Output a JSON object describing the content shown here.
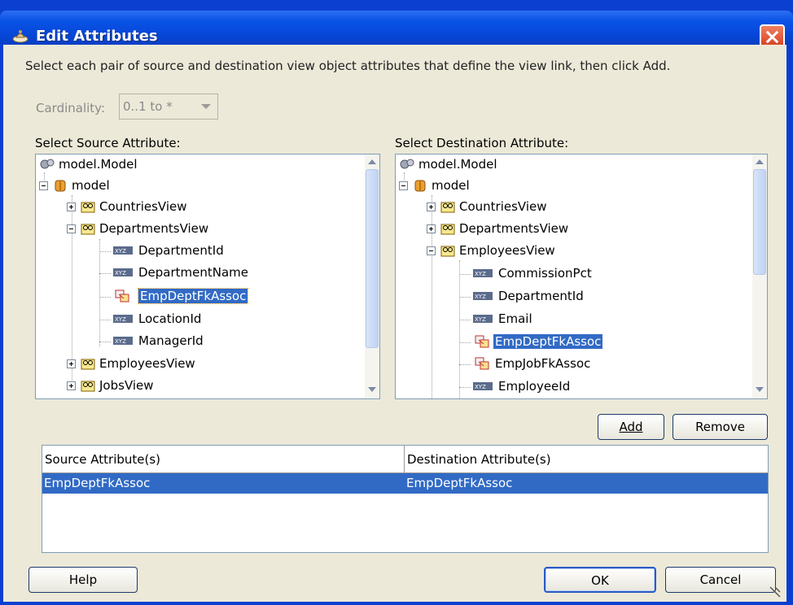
{
  "window": {
    "title": "Edit Attributes"
  },
  "instruction": "Select each pair of source and destination view object attributes that define the view link, then click Add.",
  "cardinality": {
    "label": "Cardinality:",
    "value": "0..1 to *"
  },
  "source": {
    "label": "Select Source Attribute:",
    "rows": [
      "model.Model",
      "model",
      "CountriesView",
      "DepartmentsView",
      "DepartmentId",
      "DepartmentName",
      "EmpDeptFkAssoc",
      "LocationId",
      "ManagerId",
      "EmployeesView",
      "JobsView"
    ]
  },
  "destination": {
    "label": "Select Destination Attribute:",
    "rows": [
      "model.Model",
      "model",
      "CountriesView",
      "DepartmentsView",
      "EmployeesView",
      "CommissionPct",
      "DepartmentId",
      "Email",
      "EmpDeptFkAssoc",
      "EmpJobFkAssoc",
      "EmployeeId"
    ]
  },
  "buttons": {
    "add": "Add",
    "remove": "Remove",
    "help": "Help",
    "ok": "OK",
    "cancel": "Cancel"
  },
  "table": {
    "columns": [
      "Source Attribute(s)",
      "Destination Attribute(s)"
    ],
    "rows": [
      [
        "EmpDeptFkAssoc",
        "EmpDeptFkAssoc"
      ]
    ]
  },
  "colors": {
    "selection": "#316ac5",
    "titlebar": "#0a53e6"
  }
}
